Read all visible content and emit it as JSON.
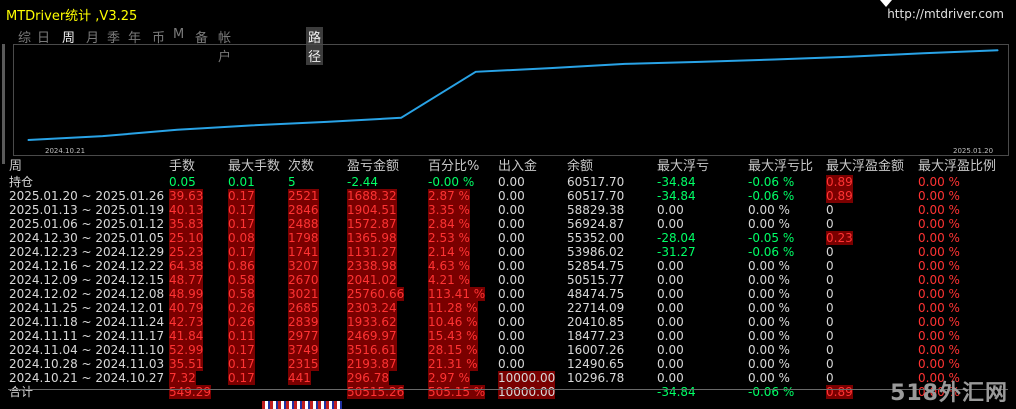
{
  "window": {
    "title": "MTDriver统计 ,V3.25",
    "url": "http://mtdriver.com"
  },
  "tabs": [
    {
      "label": "综",
      "active": false
    },
    {
      "label": "日",
      "active": false
    },
    {
      "label": "周",
      "active": true
    },
    {
      "label": "月",
      "active": false
    },
    {
      "label": "季",
      "active": false
    },
    {
      "label": "年",
      "active": false
    },
    {
      "label": "币",
      "active": false
    },
    {
      "label": "M",
      "active": false
    },
    {
      "label": "备",
      "active": false
    },
    {
      "label": "帐户",
      "active": false
    },
    {
      "label": "路径",
      "active": false
    }
  ],
  "chart_data": {
    "type": "line",
    "x_labels": [
      "2024.10.21",
      "2025.01.20"
    ],
    "x": [
      "2024.10.21",
      "2024.10.28",
      "2024.11.04",
      "2024.11.11",
      "2024.11.18",
      "2024.11.25",
      "2024.12.02",
      "2024.12.09",
      "2024.12.16",
      "2024.12.23",
      "2024.12.30",
      "2025.01.06",
      "2025.01.13",
      "2025.01.20"
    ],
    "values": [
      10296.78,
      12490.65,
      16007.26,
      18477.23,
      20410.85,
      22714.09,
      48474.75,
      50515.77,
      52854.75,
      53986.02,
      55352.0,
      56924.87,
      58829.38,
      60517.7
    ],
    "line_color": "#29a3e6",
    "grid": false
  },
  "table": {
    "headers": [
      "周",
      "手数",
      "最大手数",
      "次数",
      "盈亏金额",
      "百分比%",
      "出入金",
      "余额",
      "最大浮亏",
      "最大浮亏比",
      "最大浮盈金额",
      "最大浮盈比例"
    ],
    "rows": [
      [
        "持仓",
        "0.05",
        "0.01",
        "5",
        "-2.44",
        "-0.00 %",
        "0.00",
        "60517.70",
        "-34.84",
        "-0.06 %",
        "0.89",
        "0.00 %"
      ],
      [
        "2025.01.20 ~ 2025.01.26",
        "39.63",
        "0.17",
        "2521",
        "1688.32",
        "2.87 %",
        "0.00",
        "60517.70",
        "-34.84",
        "-0.06 %",
        "0.89",
        "0.00 %"
      ],
      [
        "2025.01.13 ~ 2025.01.19",
        "40.13",
        "0.17",
        "2846",
        "1904.51",
        "3.35 %",
        "0.00",
        "58829.38",
        "0.00",
        "0.00 %",
        "0",
        "0.00 %"
      ],
      [
        "2025.01.06 ~ 2025.01.12",
        "35.83",
        "0.17",
        "2488",
        "1572.87",
        "2.84 %",
        "0.00",
        "56924.87",
        "0.00",
        "0.00 %",
        "0",
        "0.00 %"
      ],
      [
        "2024.12.30 ~ 2025.01.05",
        "25.10",
        "0.08",
        "1798",
        "1365.98",
        "2.53 %",
        "0.00",
        "55352.00",
        "-28.04",
        "-0.05 %",
        "0.23",
        "0.00 %"
      ],
      [
        "2024.12.23 ~ 2024.12.29",
        "25.23",
        "0.17",
        "1741",
        "1131.27",
        "2.14 %",
        "0.00",
        "53986.02",
        "-31.27",
        "-0.06 %",
        "0",
        "0.00 %"
      ],
      [
        "2024.12.16 ~ 2024.12.22",
        "64.38",
        "0.86",
        "3207",
        "2338.98",
        "4.63 %",
        "0.00",
        "52854.75",
        "0.00",
        "0.00 %",
        "0",
        "0.00 %"
      ],
      [
        "2024.12.09 ~ 2024.12.15",
        "48.77",
        "0.58",
        "2670",
        "2041.02",
        "4.21 %",
        "0.00",
        "50515.77",
        "0.00",
        "0.00 %",
        "0",
        "0.00 %"
      ],
      [
        "2024.12.02 ~ 2024.12.08",
        "48.99",
        "0.58",
        "3021",
        "25760.66",
        "113.41 %",
        "0.00",
        "48474.75",
        "0.00",
        "0.00 %",
        "0",
        "0.00 %"
      ],
      [
        "2024.11.25 ~ 2024.12.01",
        "40.79",
        "0.26",
        "2685",
        "2303.24",
        "11.28 %",
        "0.00",
        "22714.09",
        "0.00",
        "0.00 %",
        "0",
        "0.00 %"
      ],
      [
        "2024.11.18 ~ 2024.11.24",
        "42.73",
        "0.26",
        "2839",
        "1933.62",
        "10.46 %",
        "0.00",
        "20410.85",
        "0.00",
        "0.00 %",
        "0",
        "0.00 %"
      ],
      [
        "2024.11.11 ~ 2024.11.17",
        "41.84",
        "0.11",
        "2977",
        "2469.97",
        "15.43 %",
        "0.00",
        "18477.23",
        "0.00",
        "0.00 %",
        "0",
        "0.00 %"
      ],
      [
        "2024.11.04 ~ 2024.11.10",
        "52.99",
        "0.17",
        "3749",
        "3516.61",
        "28.15 %",
        "0.00",
        "16007.26",
        "0.00",
        "0.00 %",
        "0",
        "0.00 %"
      ],
      [
        "2024.10.28 ~ 2024.11.03",
        "35.51",
        "0.17",
        "2315",
        "2193.87",
        "21.31 %",
        "0.00",
        "12490.65",
        "0.00",
        "0.00 %",
        "0",
        "0.00 %"
      ],
      [
        "2024.10.21 ~ 2024.10.27",
        "7.32",
        "0.17",
        "441",
        "296.78",
        "2.97 %",
        "10000.00",
        "10296.78",
        "0.00",
        "0.00 %",
        "0",
        "0.00 %"
      ],
      [
        "合计",
        "549.29",
        "",
        "",
        "50515.26",
        "505.15 %",
        "10000.00",
        "",
        "-34.84",
        "-0.06 %",
        "0.89",
        "0.00 %"
      ]
    ]
  },
  "colors": {
    "positive": "#00ff66",
    "negative": "#ff3333",
    "neutral": "#d8d8d8",
    "highlight_bg": "#7a0000",
    "title": "#ffff00"
  },
  "watermark": "518外汇网"
}
